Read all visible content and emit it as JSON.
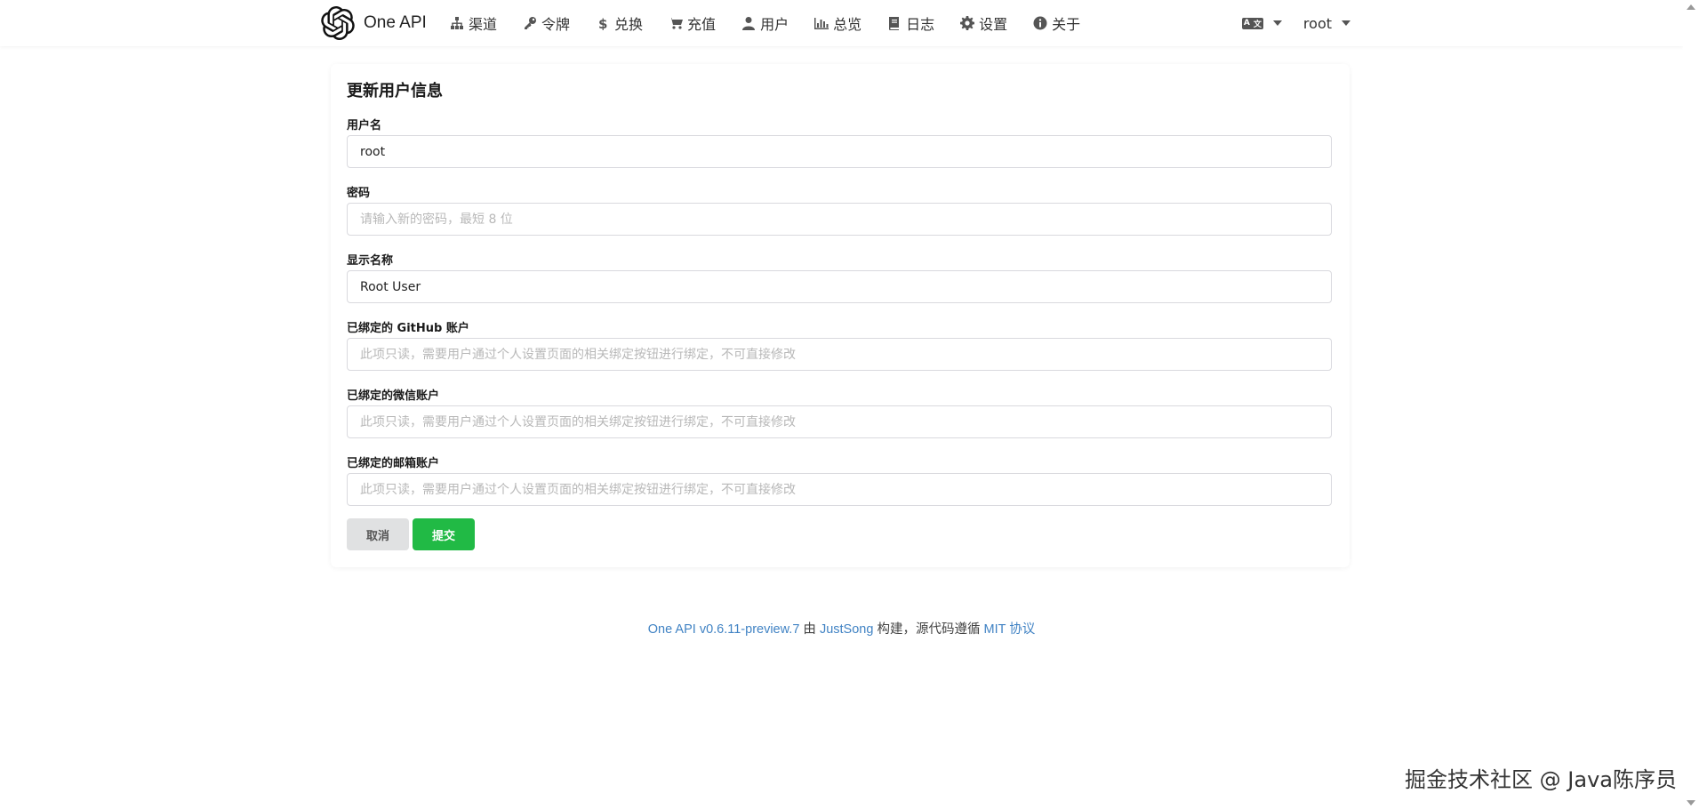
{
  "nav": {
    "brand": "One API",
    "items": [
      {
        "label": "渠道",
        "icon": "sitemap-icon"
      },
      {
        "label": "令牌",
        "icon": "key-icon"
      },
      {
        "label": "兑换",
        "icon": "dollar-icon"
      },
      {
        "label": "充值",
        "icon": "cart-icon"
      },
      {
        "label": "用户",
        "icon": "user-icon"
      },
      {
        "label": "总览",
        "icon": "bar-chart-icon"
      },
      {
        "label": "日志",
        "icon": "book-icon"
      },
      {
        "label": "设置",
        "icon": "gear-icon"
      },
      {
        "label": "关于",
        "icon": "info-icon"
      }
    ],
    "language_icon": "language-icon",
    "user": "root"
  },
  "form": {
    "title": "更新用户信息",
    "username_label": "用户名",
    "username_value": "root",
    "password_label": "密码",
    "password_placeholder": "请输入新的密码，最短 8 位",
    "display_name_label": "显示名称",
    "display_name_value": "Root User",
    "github_label": "已绑定的 GitHub 账户",
    "github_placeholder": "此项只读，需要用户通过个人设置页面的相关绑定按钮进行绑定，不可直接修改",
    "wechat_label": "已绑定的微信账户",
    "wechat_placeholder": "此项只读，需要用户通过个人设置页面的相关绑定按钮进行绑定，不可直接修改",
    "email_label": "已绑定的邮箱账户",
    "email_placeholder": "此项只读，需要用户通过个人设置页面的相关绑定按钮进行绑定，不可直接修改",
    "cancel_label": "取消",
    "submit_label": "提交"
  },
  "footer": {
    "version_link": "One API v0.6.11-preview.7",
    "by": " 由 ",
    "author_link": "JustSong",
    "built": " 构建，源代码遵循 ",
    "license_link": "MIT 协议"
  },
  "watermark": "掘金技术社区 @ Java陈序员",
  "colors": {
    "primary_green": "#21ba45",
    "link_blue": "#4183c4",
    "cancel_grey": "#e0e1e2"
  }
}
